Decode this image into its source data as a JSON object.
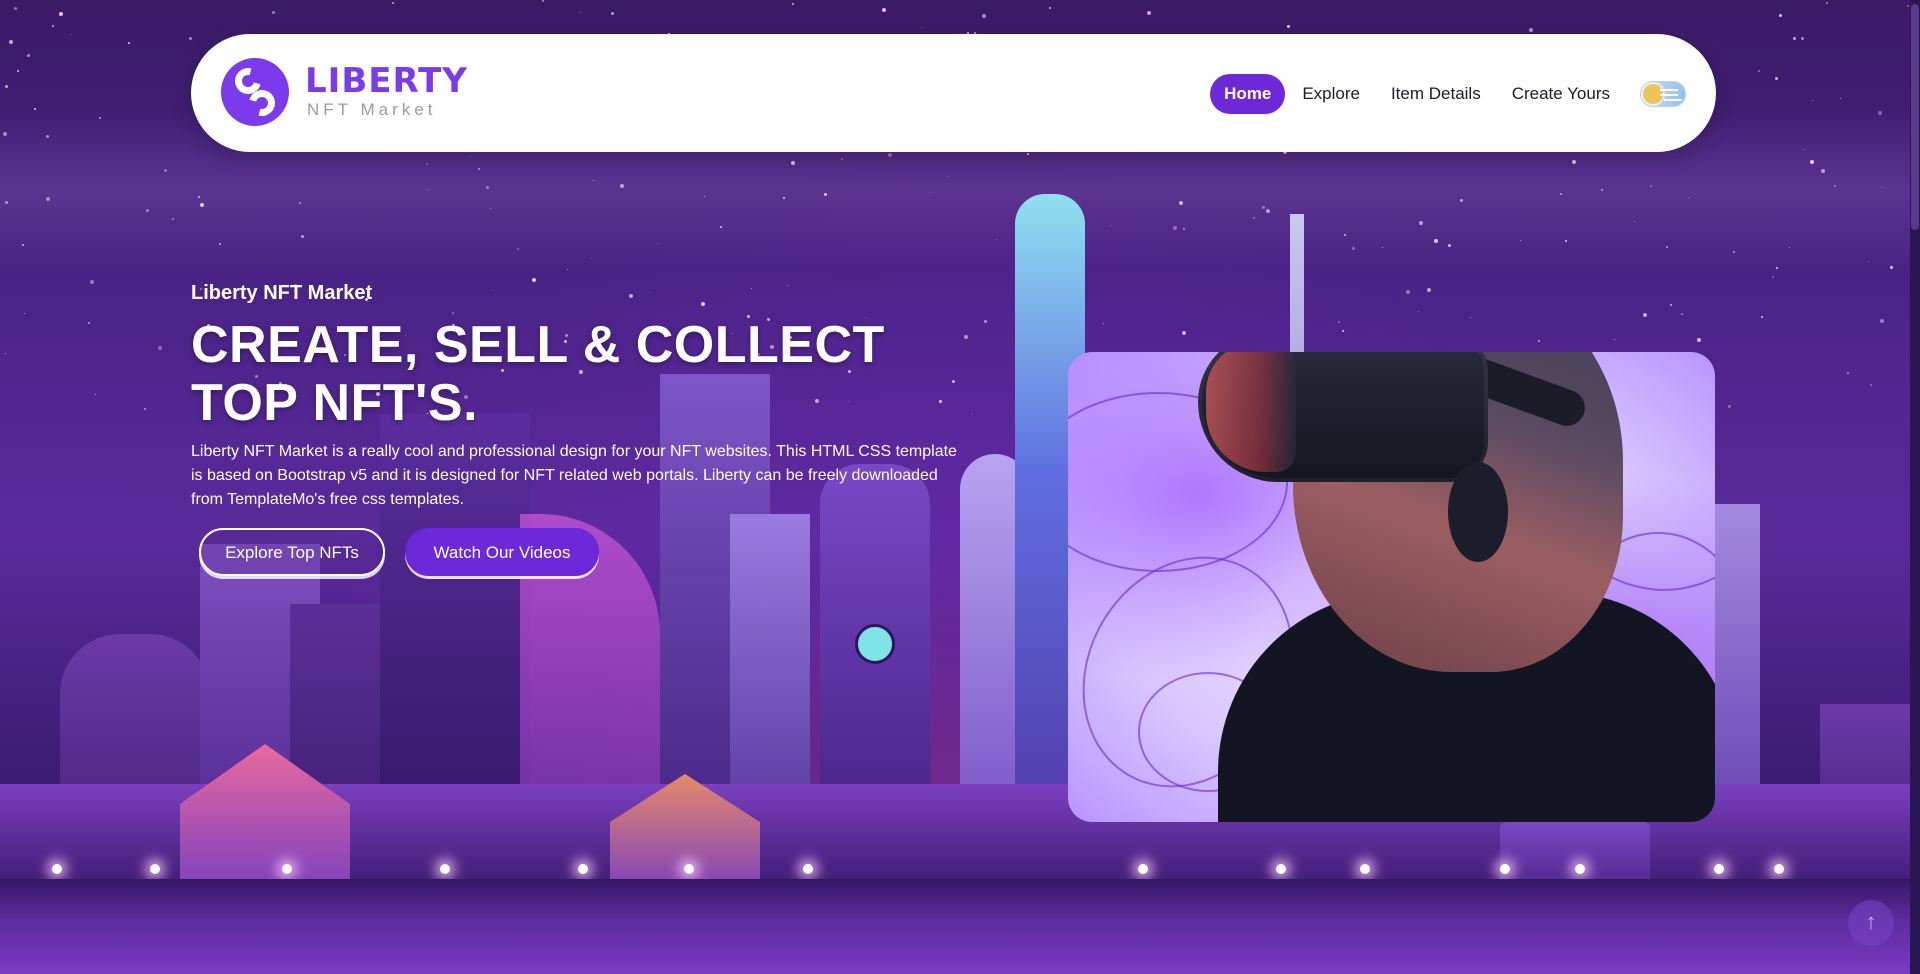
{
  "header": {
    "logo_title": "LIBERTY",
    "logo_subtitle": "NFT Market",
    "nav": {
      "home": "Home",
      "explore": "Explore",
      "item_details": "Item Details",
      "create_yours": "Create Yours"
    },
    "toggle_icon": "theme-toggle-icon"
  },
  "hero": {
    "subtitle": "Liberty NFT Market",
    "title": "CREATE, SELL & COLLECT TOP NFT'S.",
    "description": "Liberty NFT Market is a really cool and professional design for your NFT websites. This HTML CSS template is based on Bootstrap v5 and it is designed for NFT related web portals. Liberty can be freely downloaded from TemplateMo's free css templates.",
    "btn_explore": "Explore Top NFTs",
    "btn_videos": "Watch Our Videos",
    "image_icon": "vr-person-image"
  },
  "colors": {
    "accent": "#6d28d9",
    "logo": "#7c3aed"
  },
  "scroll_top_icon": "arrow-up-icon"
}
